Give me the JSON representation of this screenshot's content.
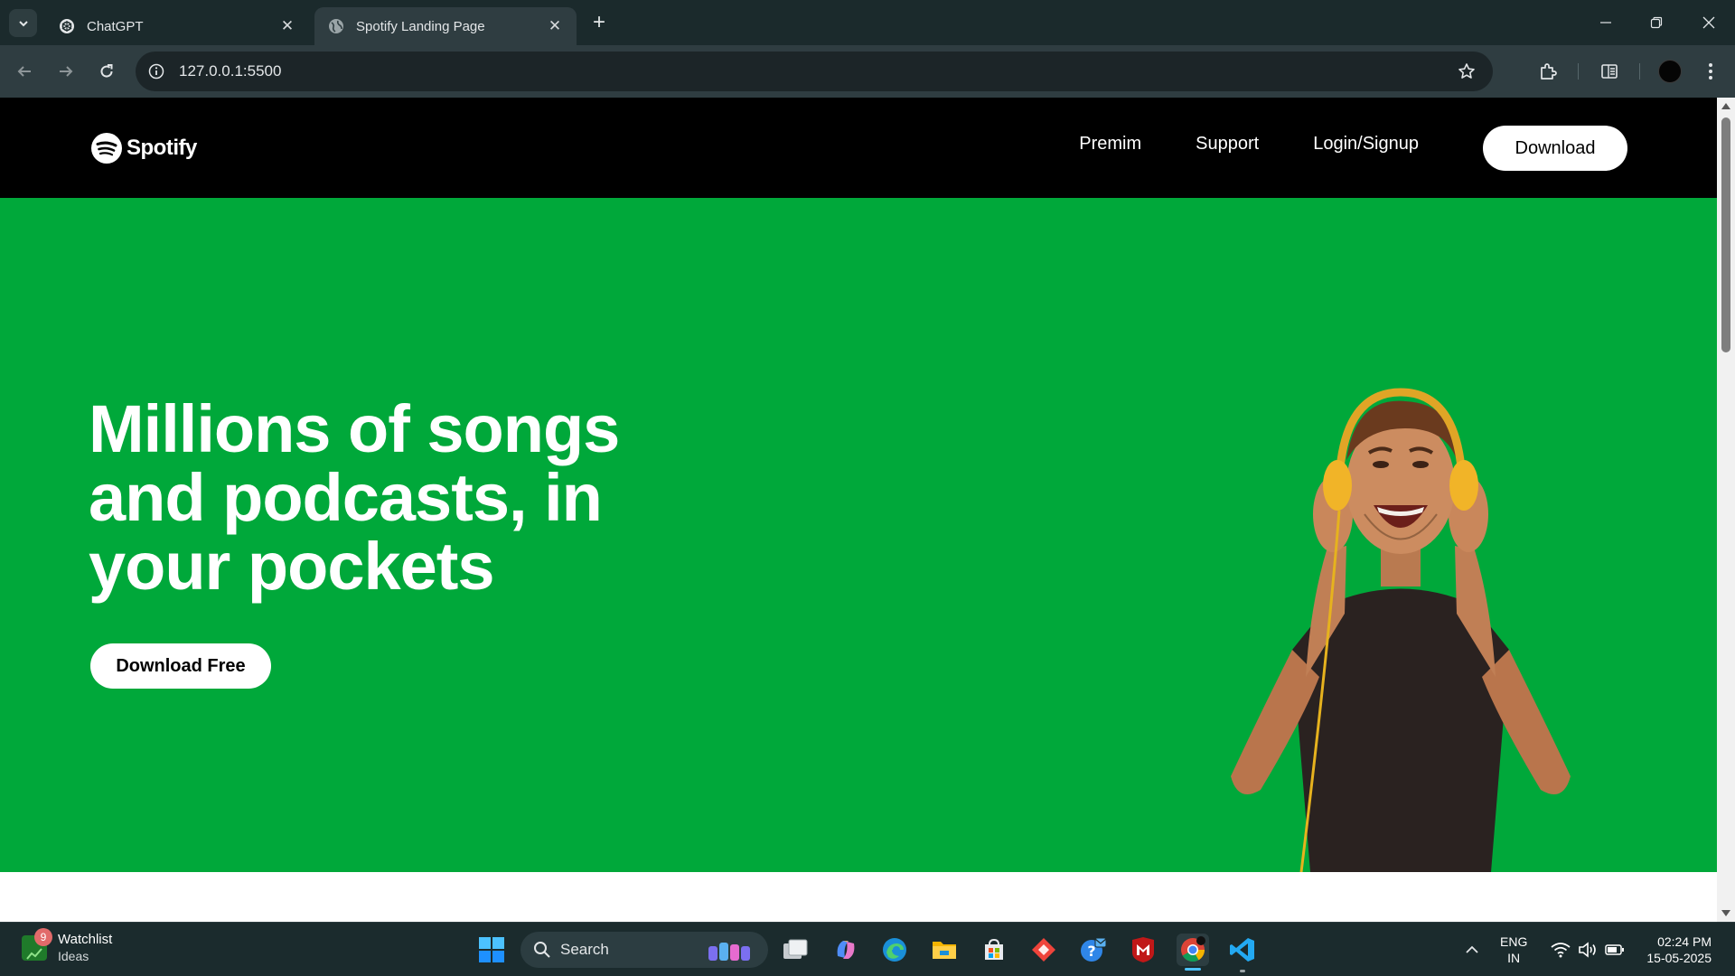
{
  "browser": {
    "tabs": [
      {
        "title": "ChatGPT",
        "favicon": "chatgpt-icon",
        "active": false
      },
      {
        "title": "Spotify Landing Page",
        "favicon": "globe-icon",
        "active": true
      }
    ],
    "url": "127.0.0.1:5500"
  },
  "site": {
    "logo_text": "Spotify",
    "nav_links": [
      "Premim",
      "Support",
      "Login/Signup"
    ],
    "download_label": "Download",
    "headline": "Millions of songs and podcasts, in your pockets",
    "cta_label": "Download Free",
    "colors": {
      "hero_bg": "#00a83a",
      "nav_bg": "#000000",
      "button_bg": "#ffffff"
    }
  },
  "taskbar": {
    "widget": {
      "title": "Watchlist",
      "subtitle": "Ideas",
      "badge": "9"
    },
    "search_label": "Search",
    "lang_line1": "ENG",
    "lang_line2": "IN",
    "time": "02:24 PM",
    "date": "15-05-2025"
  }
}
